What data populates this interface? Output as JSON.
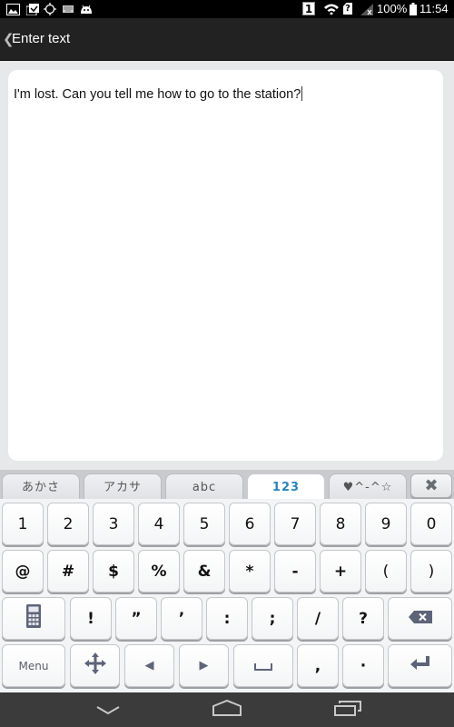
{
  "status_bar": {
    "left_icons": [
      "image-notification-icon",
      "clipboard-check-icon",
      "gps-target-icon",
      "keyboard-icon",
      "android-debug-icon"
    ],
    "right_icons": [
      "sim-1-icon",
      "wifi-icon",
      "sim-unknown-icon",
      "no-signal-icon",
      "battery-icon"
    ],
    "sim_label": "1",
    "sim_unknown_label": "?",
    "battery": "100%",
    "time": "11:54"
  },
  "action_bar": {
    "back_glyph": "❮",
    "title": "Enter text"
  },
  "editor": {
    "value": "I'm lost. Can you tell me how to go to the station?"
  },
  "keyboard": {
    "tabs": [
      {
        "label": "あかさ",
        "active": false
      },
      {
        "label": "アカサ",
        "active": false
      },
      {
        "label": "abc",
        "active": false
      },
      {
        "label": "123",
        "active": true
      },
      {
        "label": "♥^-^☆",
        "active": false
      }
    ],
    "close_label": "✖",
    "accent_color": "#2a84b8",
    "row1": [
      "1",
      "2",
      "3",
      "4",
      "5",
      "6",
      "7",
      "8",
      "9",
      "0"
    ],
    "row2": [
      "@",
      "#",
      "$",
      "%",
      "&",
      "*",
      "-",
      "+",
      "(",
      ")"
    ],
    "row3": {
      "calculator": "calculator-icon",
      "keys": [
        "!",
        "”",
        "’",
        ":",
        ";",
        "/",
        "?"
      ],
      "backspace": "backspace-icon"
    },
    "row4": {
      "menu_label": "Menu",
      "move": "move-cursor-icon",
      "left": "◀",
      "right": "▶",
      "space": "space-icon",
      "comma": ",",
      "period": "·",
      "enter": "enter-icon"
    }
  },
  "nav_bar": {
    "buttons": [
      "back-down-icon",
      "home-icon",
      "recent-apps-icon"
    ]
  }
}
